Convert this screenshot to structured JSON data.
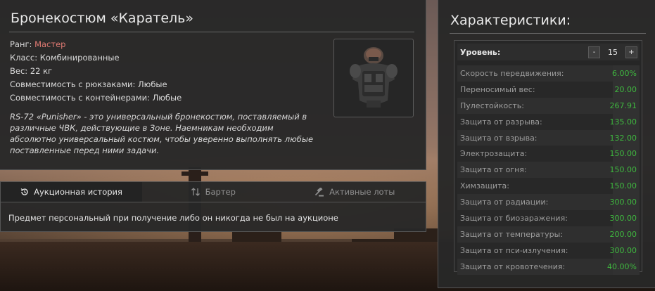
{
  "item": {
    "title": "Бронекостюм «Каратель»",
    "rank_label": "Ранг:",
    "rank_value": "Мастер",
    "class_text": "Класс: Комбинированные",
    "weight_text": "Вес: 22 кг",
    "backpack_compat": "Совместимость с рюкзаками: Любые",
    "container_compat": "Совместимость с контейнерами: Любые",
    "description": "RS-72 «Punisher» - это универсальный бронекостюм, поставляемый в различные ЧВК, действующие в Зоне. Наемникам необходим абсолютно универсальный костюм, чтобы уверенно выполнять любые поставленные перед ними задачи.",
    "thumbnail_icon": "armor-suit-image"
  },
  "tabs": [
    {
      "label": "Аукционная история",
      "icon": "history-icon",
      "active": true
    },
    {
      "label": "Бартер",
      "icon": "swap-arrows-icon",
      "active": false
    },
    {
      "label": "Активные лоты",
      "icon": "gavel-icon",
      "active": false
    }
  ],
  "tab_content": "Предмет персональный при получение либо он никогда не был на аукционе",
  "stats": {
    "title": "Характеристики:",
    "level_label": "Уровень:",
    "level_value": "15",
    "decrement": "-",
    "increment": "+",
    "rows": [
      {
        "name": "Скорость передвижения:",
        "value": "6.00%"
      },
      {
        "name": "Переносимый вес:",
        "value": "20.00"
      },
      {
        "name": "Пулестойкость:",
        "value": "267.91"
      },
      {
        "name": "Защита от разрыва:",
        "value": "135.00"
      },
      {
        "name": "Защита от взрыва:",
        "value": "132.00"
      },
      {
        "name": "Электрозащита:",
        "value": "150.00"
      },
      {
        "name": "Защита от огня:",
        "value": "150.00"
      },
      {
        "name": "Химзащита:",
        "value": "150.00"
      },
      {
        "name": "Защита от радиации:",
        "value": "300.00"
      },
      {
        "name": "Защита от биозаражения:",
        "value": "300.00"
      },
      {
        "name": "Защита от температуры:",
        "value": "200.00"
      },
      {
        "name": "Защита от пси-излучения:",
        "value": "300.00"
      },
      {
        "name": "Защита от кровотечения:",
        "value": "40.00%"
      }
    ],
    "value_color": "#3fb83f"
  },
  "colors": {
    "rank": "#e07a72",
    "panel": "#282828"
  }
}
